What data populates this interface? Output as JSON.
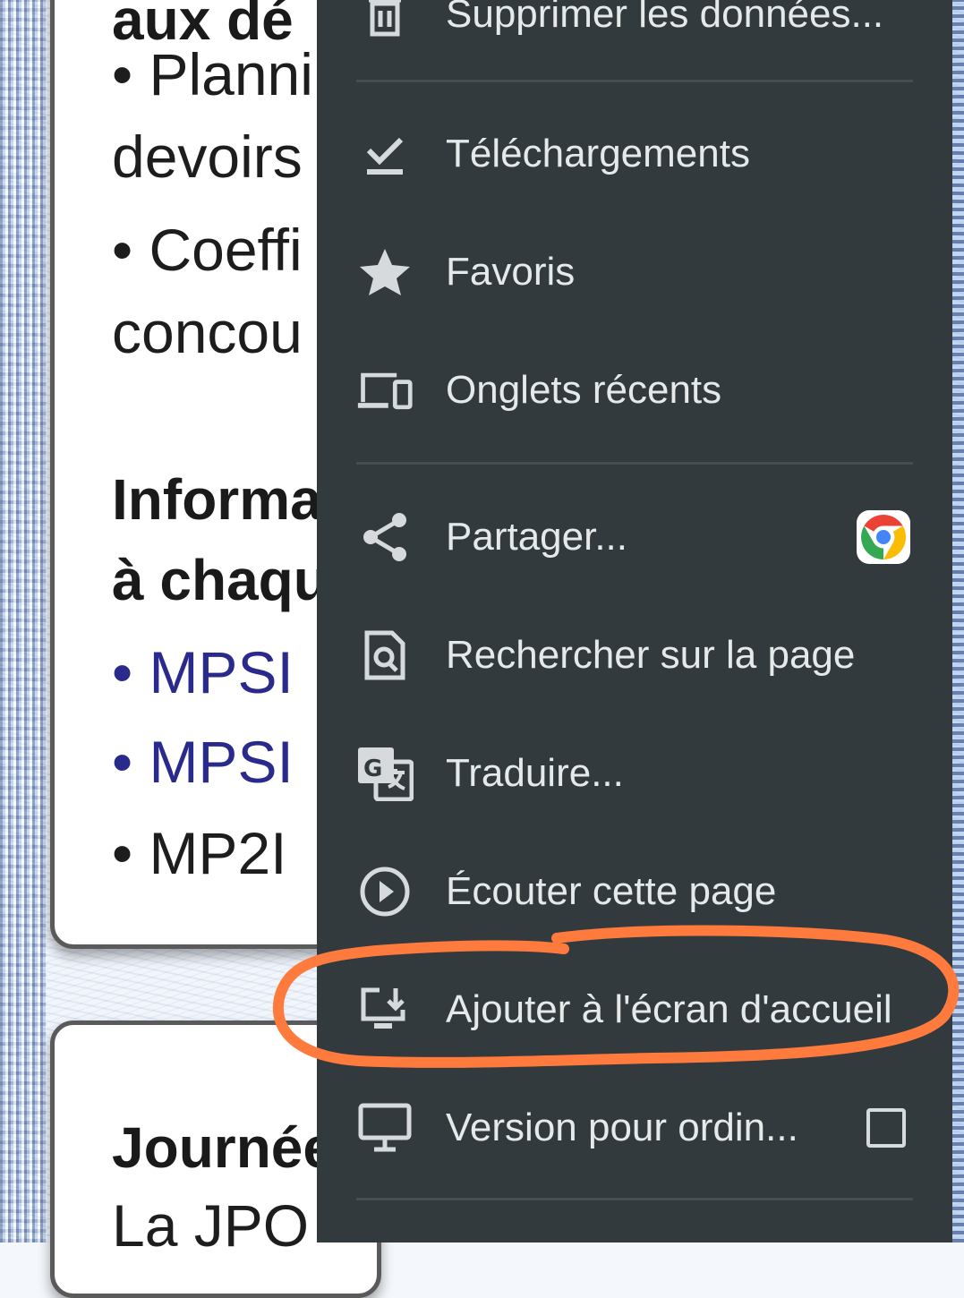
{
  "page": {
    "card1": {
      "lines": [
        {
          "text": "aux dé",
          "kind": "head"
        },
        {
          "text": "• Planni",
          "kind": "body"
        },
        {
          "text": "devoirs",
          "kind": "body"
        },
        {
          "text": "• Coeffi",
          "kind": "body"
        },
        {
          "text": "concou",
          "kind": "body"
        },
        {
          "text": "Informa",
          "kind": "head"
        },
        {
          "text": "à chaqu",
          "kind": "head"
        },
        {
          "text": "• MPSI",
          "kind": "link"
        },
        {
          "text": "• MPSI",
          "kind": "link"
        },
        {
          "text": "• MP2I",
          "kind": "body"
        }
      ]
    },
    "card2": {
      "lines": [
        {
          "text": "Journée",
          "kind": "head"
        },
        {
          "text": "La JPO",
          "kind": "body"
        }
      ]
    }
  },
  "menu": {
    "items": [
      {
        "label": "Supprimer les données...",
        "icon": "trash-icon"
      },
      {
        "label": "Téléchargements",
        "icon": "download-check-icon"
      },
      {
        "label": "Favoris",
        "icon": "star-icon"
      },
      {
        "label": "Onglets récents",
        "icon": "devices-icon"
      },
      {
        "label": "Partager...",
        "icon": "share-icon"
      },
      {
        "label": "Rechercher sur la page",
        "icon": "find-in-page-icon"
      },
      {
        "label": "Traduire...",
        "icon": "translate-icon"
      },
      {
        "label": "Écouter cette page",
        "icon": "play-circle-icon"
      },
      {
        "label": "Ajouter à l'écran d'accueil",
        "icon": "add-to-home-icon"
      },
      {
        "label": "Version pour ordin...",
        "icon": "desktop-icon",
        "checked": false
      }
    ]
  },
  "colors": {
    "menu_bg": "#323a3e",
    "menu_text": "#e6e9ea",
    "link": "#2a2a8c",
    "highlight": "#ff7a3d"
  }
}
